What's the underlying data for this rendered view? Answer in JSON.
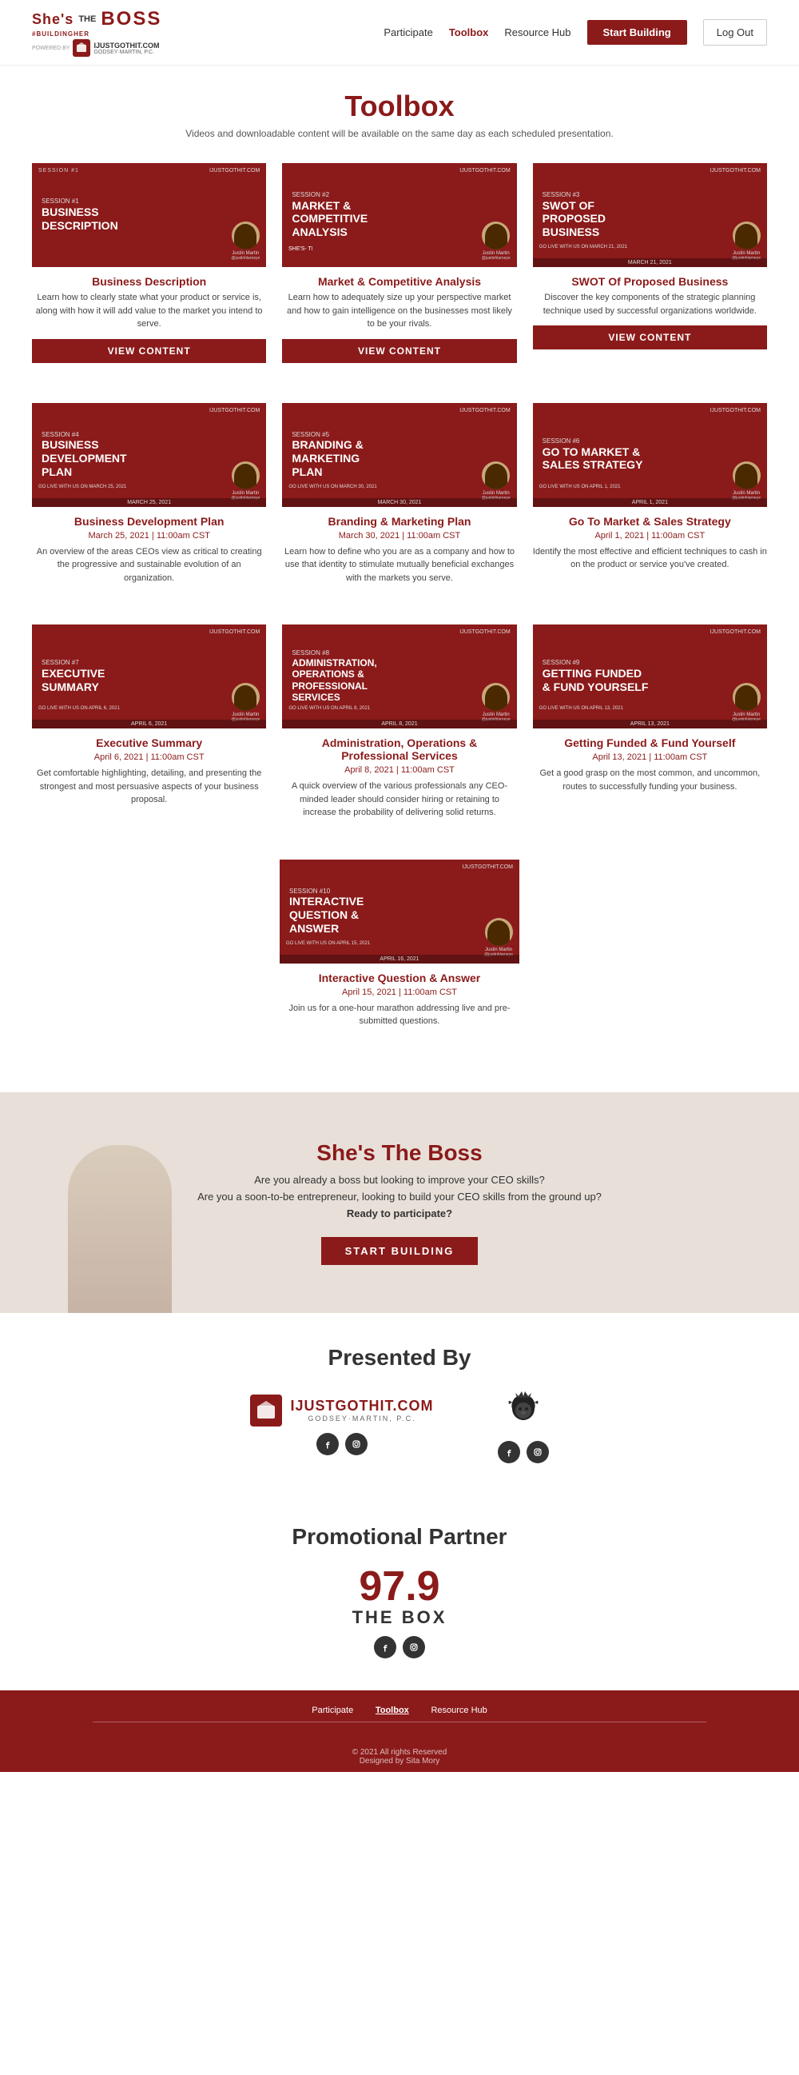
{
  "header": {
    "logo": {
      "shes": "She's",
      "the": "THE",
      "boss": "BOSS",
      "hashtag": "#BUILDINGHER",
      "powered": "POWERED BY",
      "partner_name": "IJUSTGOTHIT.COM",
      "partner_sub": "GODSEY·MARTIN, P.C."
    },
    "nav": [
      {
        "label": "Participate",
        "active": false
      },
      {
        "label": "Toolbox",
        "active": true
      },
      {
        "label": "Resource Hub",
        "active": false
      }
    ],
    "start_btn": "Start Building",
    "logout_btn": "Log Out"
  },
  "page": {
    "title": "Toolbox",
    "subtitle": "Videos and downloadable content will be available on the same day as each scheduled presentation."
  },
  "sessions": [
    {
      "session_num": "SESSION #1",
      "title": "BUSINESS\nDESCRIPTION",
      "name": "Business Description",
      "date": null,
      "description": "Learn how to clearly state what your product or service is, along with how it will add value to the market you intend to serve.",
      "has_button": true,
      "button_label": "VIEW CONTENT",
      "go_live": null,
      "presenter": "Justin Martin\n@justinhlarneye"
    },
    {
      "session_num": "SESSION #2",
      "title": "MARKET &\nCOMPETITIVE\nANALYSIS",
      "name": "Market & Competitive Analysis",
      "date": null,
      "description": "Learn how to adequately size up your perspective market and how to gain intelligence on the businesses most likely to be your rivals.",
      "has_button": true,
      "button_label": "VIEW CONTENT",
      "go_live": null,
      "presenter": "Justin Martin\n@justinhlarneye"
    },
    {
      "session_num": "SESSION #3",
      "title": "SWOT OF PROPOSED\nBUSINESS",
      "name": "SWOT Of Proposed Business",
      "date": null,
      "description": "Discover the key components of the strategic planning technique used by successful organizations worldwide.",
      "has_button": true,
      "button_label": "VIEW CONTENT",
      "go_live": null,
      "presenter": "Justin Martin\n@justinhlarneye"
    },
    {
      "session_num": "SESSION #4",
      "title": "BUSINESS\nDEVELOPMENT PLAN",
      "name": "Business Development Plan",
      "date": "March 25, 2021 | 11:00am CST",
      "description": "An overview of the areas CEOs view as critical to creating the progressive and sustainable evolution of an organization.",
      "has_button": false,
      "button_label": null,
      "go_live": "GO LIVE WITH US ON MARCH 25, 2021",
      "presenter": "Justin Martin\n@justinhlarneye"
    },
    {
      "session_num": "SESSION #5",
      "title": "BRANDING &\nMARKETING PLAN",
      "name": "Branding & Marketing Plan",
      "date": "March 30, 2021 | 11:00am CST",
      "description": "Learn how to define who you are as a company and how to use that identity to stimulate mutually beneficial exchanges with the markets you serve.",
      "has_button": false,
      "button_label": null,
      "go_live": "GO LIVE WITH US ON MARCH 30, 2021",
      "presenter": "Justin Martin\n@justinhlarneye"
    },
    {
      "session_num": "SESSION #6",
      "title": "GO TO MARKET &\nSALES STRATEGY",
      "name": "Go To Market & Sales Strategy",
      "date": "April 1, 2021 | 11:00am CST",
      "description": "Identify the most effective and efficient techniques to cash in on the product or service you've created.",
      "has_button": false,
      "button_label": null,
      "go_live": "GO LIVE WITH US ON APRIL 1, 2021",
      "presenter": "Justin Martin\n@justinhlarneye"
    },
    {
      "session_num": "SESSION #7",
      "title": "EXECUTIVE\nSUMMARY",
      "name": "Executive Summary",
      "date": "April 6, 2021 | 11:00am CST",
      "description": "Get comfortable highlighting, detailing, and presenting the strongest and most persuasive aspects of your business proposal.",
      "has_button": false,
      "button_label": null,
      "go_live": "GO LIVE WITH US ON APRIL 6, 2021",
      "presenter": "Justin Martin\n@justinhlarneye"
    },
    {
      "session_num": "SESSION #8",
      "title": "ADMINISTRATION,\nOPERATIONS &\nPROFESSIONAL\nSERVICES",
      "name": "Administration, Operations &\nProfessional Services",
      "date": "April 8, 2021 | 11:00am CST",
      "description": "A quick overview of the various professionals any CEO-minded leader should consider hiring or retaining to increase the probability of delivering solid returns.",
      "has_button": false,
      "button_label": null,
      "go_live": "GO LIVE WITH US ON APRIL 8, 2021",
      "presenter": "Justin Martin\n@justinhlarneye"
    },
    {
      "session_num": "SESSION #9",
      "title": "GETTING FUNDED\n& FUND YOURSELF",
      "name": "Getting Funded & Fund Yourself",
      "date": "April 13, 2021 | 11:00am CST",
      "description": "Get a good grasp on the most common, and uncommon, routes to successfully funding your business.",
      "has_button": false,
      "button_label": null,
      "go_live": "GO LIVE WITH US ON APRIL 13, 2021",
      "presenter": "Justin Martin\n@justinhlarneye"
    },
    {
      "session_num": "SESSION #10",
      "title": "INTERACTIVE\nQUESTION &\nANSWER",
      "name": "Interactive Question & Answer",
      "date": "April 15, 2021 | 11:00am CST",
      "description": "Join us for a one-hour marathon addressing live and pre-submitted questions.",
      "has_button": false,
      "button_label": null,
      "go_live": "GO LIVE WITH US ON APRIL 15, 2021",
      "presenter": "Justin Martin\n@justinhlarneye"
    }
  ],
  "banner": {
    "title": "She's The Boss",
    "line1": "Are you already a boss but looking to improve your CEO skills?",
    "line2": "Are you a soon-to-be entrepreneur, looking to build your CEO skills from the ground up?",
    "line3": "Ready to participate?",
    "btn": "START BUILDING"
  },
  "presented": {
    "title": "Presented By",
    "logos": [
      {
        "name": "IJUSTGOTHIT.COM",
        "sub": "GODSEY·MARTIN, P.C.",
        "social": [
          "facebook",
          "instagram"
        ]
      },
      {
        "name": "Lion Logo",
        "social": [
          "facebook",
          "instagram"
        ]
      }
    ]
  },
  "promo": {
    "title": "Promotional Partner",
    "radio_num": "97.9",
    "radio_name": "THE BOX",
    "social": [
      "facebook",
      "instagram"
    ]
  },
  "footer": {
    "links": [
      "Participate",
      "Toolbox",
      "Resource Hub"
    ],
    "active": "Toolbox",
    "copy": "© 2021 All rights Reserved",
    "designed": "Designed by Sita Mory"
  }
}
